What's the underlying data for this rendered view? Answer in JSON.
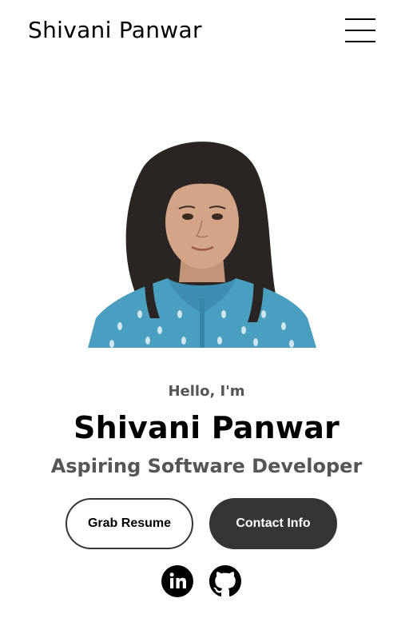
{
  "header": {
    "logo_text": "Shivani Panwar",
    "menu_icon": "hamburger-menu-icon"
  },
  "profile": {
    "photo_description_icon": "profile-photo"
  },
  "hero": {
    "greeting": "Hello, I'm",
    "name": "Shivani Panwar",
    "title": "Aspiring Software Developer"
  },
  "buttons": {
    "resume_label": "Grab Resume",
    "contact_label": "Contact Info"
  },
  "social": {
    "linkedin_icon": "linkedin-icon",
    "github_icon": "github-icon"
  },
  "colors": {
    "primary_dark": "#353535",
    "text_gray": "#555555",
    "background": "#ffffff"
  }
}
